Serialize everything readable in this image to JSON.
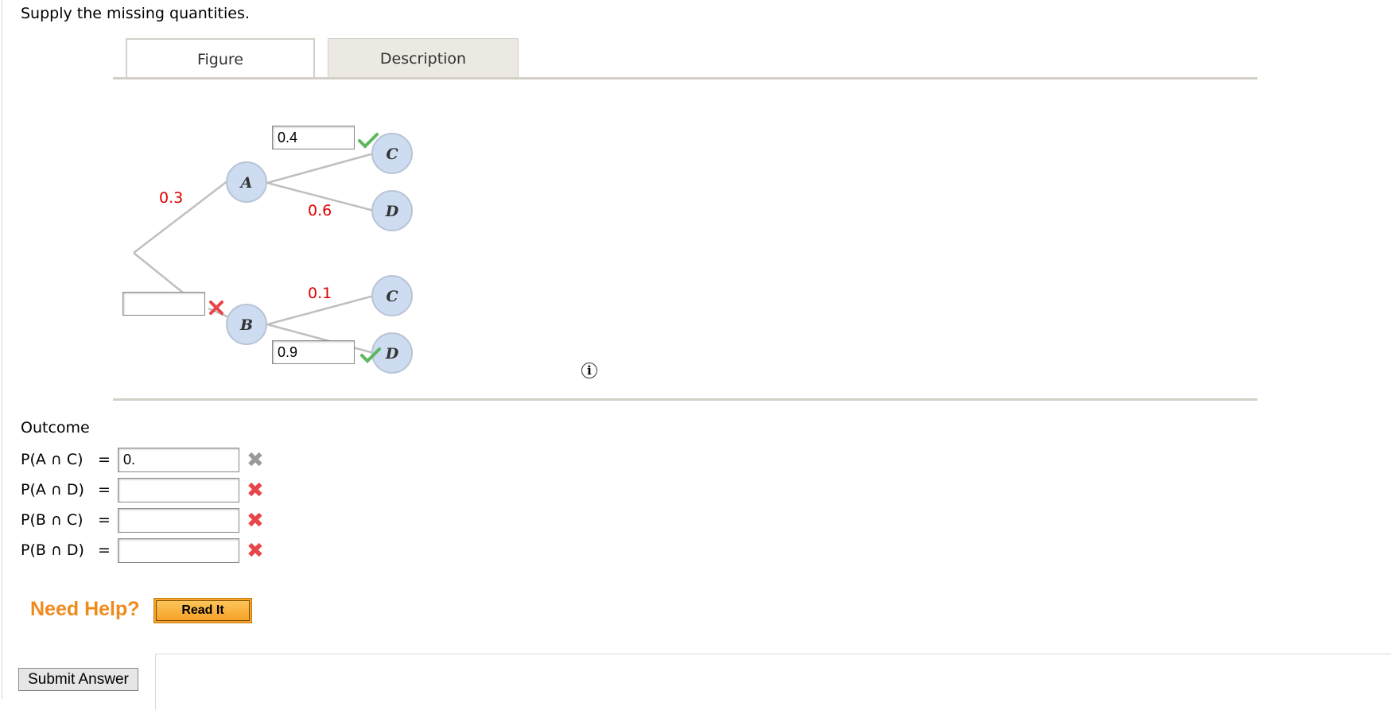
{
  "prompt": "Supply the missing quantities.",
  "tabs": {
    "figure": "Figure",
    "description": "Description"
  },
  "tree": {
    "nodes": {
      "A": "A",
      "B": "B",
      "C1": "C",
      "D1": "D",
      "C2": "C",
      "D2": "D"
    },
    "branch_labels": {
      "root_A": "0.3",
      "A_D": "0.6",
      "B_C": "0.1"
    },
    "inputs": {
      "A_C": "0.4",
      "root_B": "",
      "B_D": "0.9"
    },
    "input_status": {
      "A_C": "correct",
      "root_B": "incorrect",
      "B_D": "correct"
    },
    "colors": {
      "node_fill": "#cddcf0",
      "branch": "#bfbfbf",
      "label_red": "#e00000"
    }
  },
  "info_icon": "i",
  "outcome": {
    "title": "Outcome",
    "rows": [
      {
        "label": "P(A ∩ C)",
        "eq": "=",
        "value": "0.",
        "status": "pending"
      },
      {
        "label": "P(A ∩ D)",
        "eq": "=",
        "value": "",
        "status": "incorrect"
      },
      {
        "label": "P(B ∩ C)",
        "eq": "=",
        "value": "",
        "status": "incorrect"
      },
      {
        "label": "P(B ∩ D)",
        "eq": "=",
        "value": "",
        "status": "incorrect"
      }
    ]
  },
  "help": {
    "need_help": "Need Help?",
    "read_it": "Read It"
  },
  "submit_label": "Submit Answer"
}
